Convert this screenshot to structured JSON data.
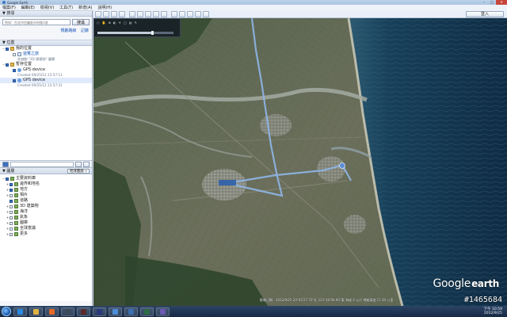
{
  "window": {
    "title": "Google Earth",
    "min": "–",
    "max": "□",
    "close": "✕"
  },
  "menu": [
    "檔案(F)",
    "編輯(E)",
    "檢視(V)",
    "工具(T)",
    "新增(A)",
    "說明(H)"
  ],
  "toolbar": {
    "login": "登入",
    "button_count": 14
  },
  "search": {
    "header": "▼ 搜尋",
    "placeholder": "例如：台北市信義區市府路1號",
    "button": "搜尋",
    "links": [
      "規劃路線",
      "記錄"
    ]
  },
  "places": {
    "header": "▼ 位置",
    "tree": [
      {
        "label": "我的位置",
        "icon": "folder-icon",
        "checked": true,
        "level": 0,
        "toggle": "−"
      },
      {
        "label": "遊覽之旅",
        "icon": "doc-icon",
        "checked": false,
        "level": 1,
        "link": true
      },
      {
        "desc": "先啟動 \"3D 建築物\" 圖層"
      },
      {
        "label": "暫存位置",
        "icon": "folder-icon",
        "checked": true,
        "level": 0,
        "toggle": "−"
      },
      {
        "label": "GPS device",
        "icon": "path-icon",
        "checked": true,
        "level": 1
      },
      {
        "desc": "Created 09/25/12 22:57:11"
      },
      {
        "label": "GPS device",
        "icon": "path-icon",
        "checked": true,
        "level": 1,
        "selected": true
      },
      {
        "desc": "Created 09/25/12 22:57:31"
      }
    ]
  },
  "layers": {
    "header": "▼ 圖層",
    "gallery": "地球畫廊 »",
    "tree": [
      {
        "label": "主要資料庫",
        "toggle": "−",
        "icon": "layer-icon",
        "checked": true,
        "level": 0
      },
      {
        "label": "邊界和地名",
        "toggle": "+",
        "icon": "layer-icon",
        "checked": true,
        "level": 1
      },
      {
        "label": "地方",
        "toggle": "+",
        "icon": "layer-icon",
        "checked": true,
        "level": 1
      },
      {
        "label": "相片",
        "toggle": "+",
        "icon": "layer-icon",
        "checked": false,
        "level": 1
      },
      {
        "label": "道路",
        "toggle": "",
        "icon": "layer-icon",
        "checked": true,
        "level": 1
      },
      {
        "label": "3D 建築物",
        "toggle": "+",
        "icon": "layer-icon",
        "checked": false,
        "level": 1
      },
      {
        "label": "海洋",
        "toggle": "+",
        "icon": "layer-icon",
        "checked": false,
        "level": 1
      },
      {
        "label": "氣象",
        "toggle": "+",
        "icon": "layer-icon",
        "checked": false,
        "level": 1
      },
      {
        "label": "圖庫",
        "toggle": "+",
        "icon": "layer-icon",
        "checked": false,
        "level": 1
      },
      {
        "label": "全球意識",
        "toggle": "+",
        "icon": "layer-icon",
        "checked": false,
        "level": 1
      },
      {
        "label": "更多",
        "toggle": "+",
        "icon": "layer-icon",
        "checked": false,
        "level": 1
      }
    ]
  },
  "map": {
    "logo_a": "Google",
    "logo_b": "earth",
    "status": "影像日期：2012/9/25    24°45'27.72\"北 121°44'06.90\"東 海拔 4 公尺    視點高度 17.30 公里",
    "watermark": "#1465684",
    "nav_labels": [
      "○",
      "✋",
      "⊕",
      "◐",
      "☀",
      "▢",
      "▤",
      "✎"
    ],
    "time_slider": 0.72,
    "colors": {
      "ocean": "#14364f",
      "land": "#5a6a52",
      "track": "#8fb6e8",
      "river": "#9aa7a4"
    }
  },
  "taskbar": {
    "apps": [
      {
        "name": "ie-icon",
        "color": "#2a8ae0"
      },
      {
        "name": "folder-icon",
        "color": "#e0b444"
      },
      {
        "name": "media-icon",
        "color": "#e46a2a"
      },
      {
        "name": "app-icon",
        "color": "#3a4a5a"
      },
      {
        "name": "app-icon",
        "color": "#5a2a2a"
      },
      {
        "name": "app-icon",
        "color": "#2a3a7a"
      },
      {
        "name": "earth-icon",
        "color": "#4c8ed6"
      },
      {
        "name": "app-icon",
        "color": "#3c6fb0"
      },
      {
        "name": "app-icon",
        "color": "#2f6c45"
      },
      {
        "name": "app-icon",
        "color": "#6a5ab0"
      }
    ],
    "time": "下午 10:59",
    "date": "2012/9/25"
  }
}
